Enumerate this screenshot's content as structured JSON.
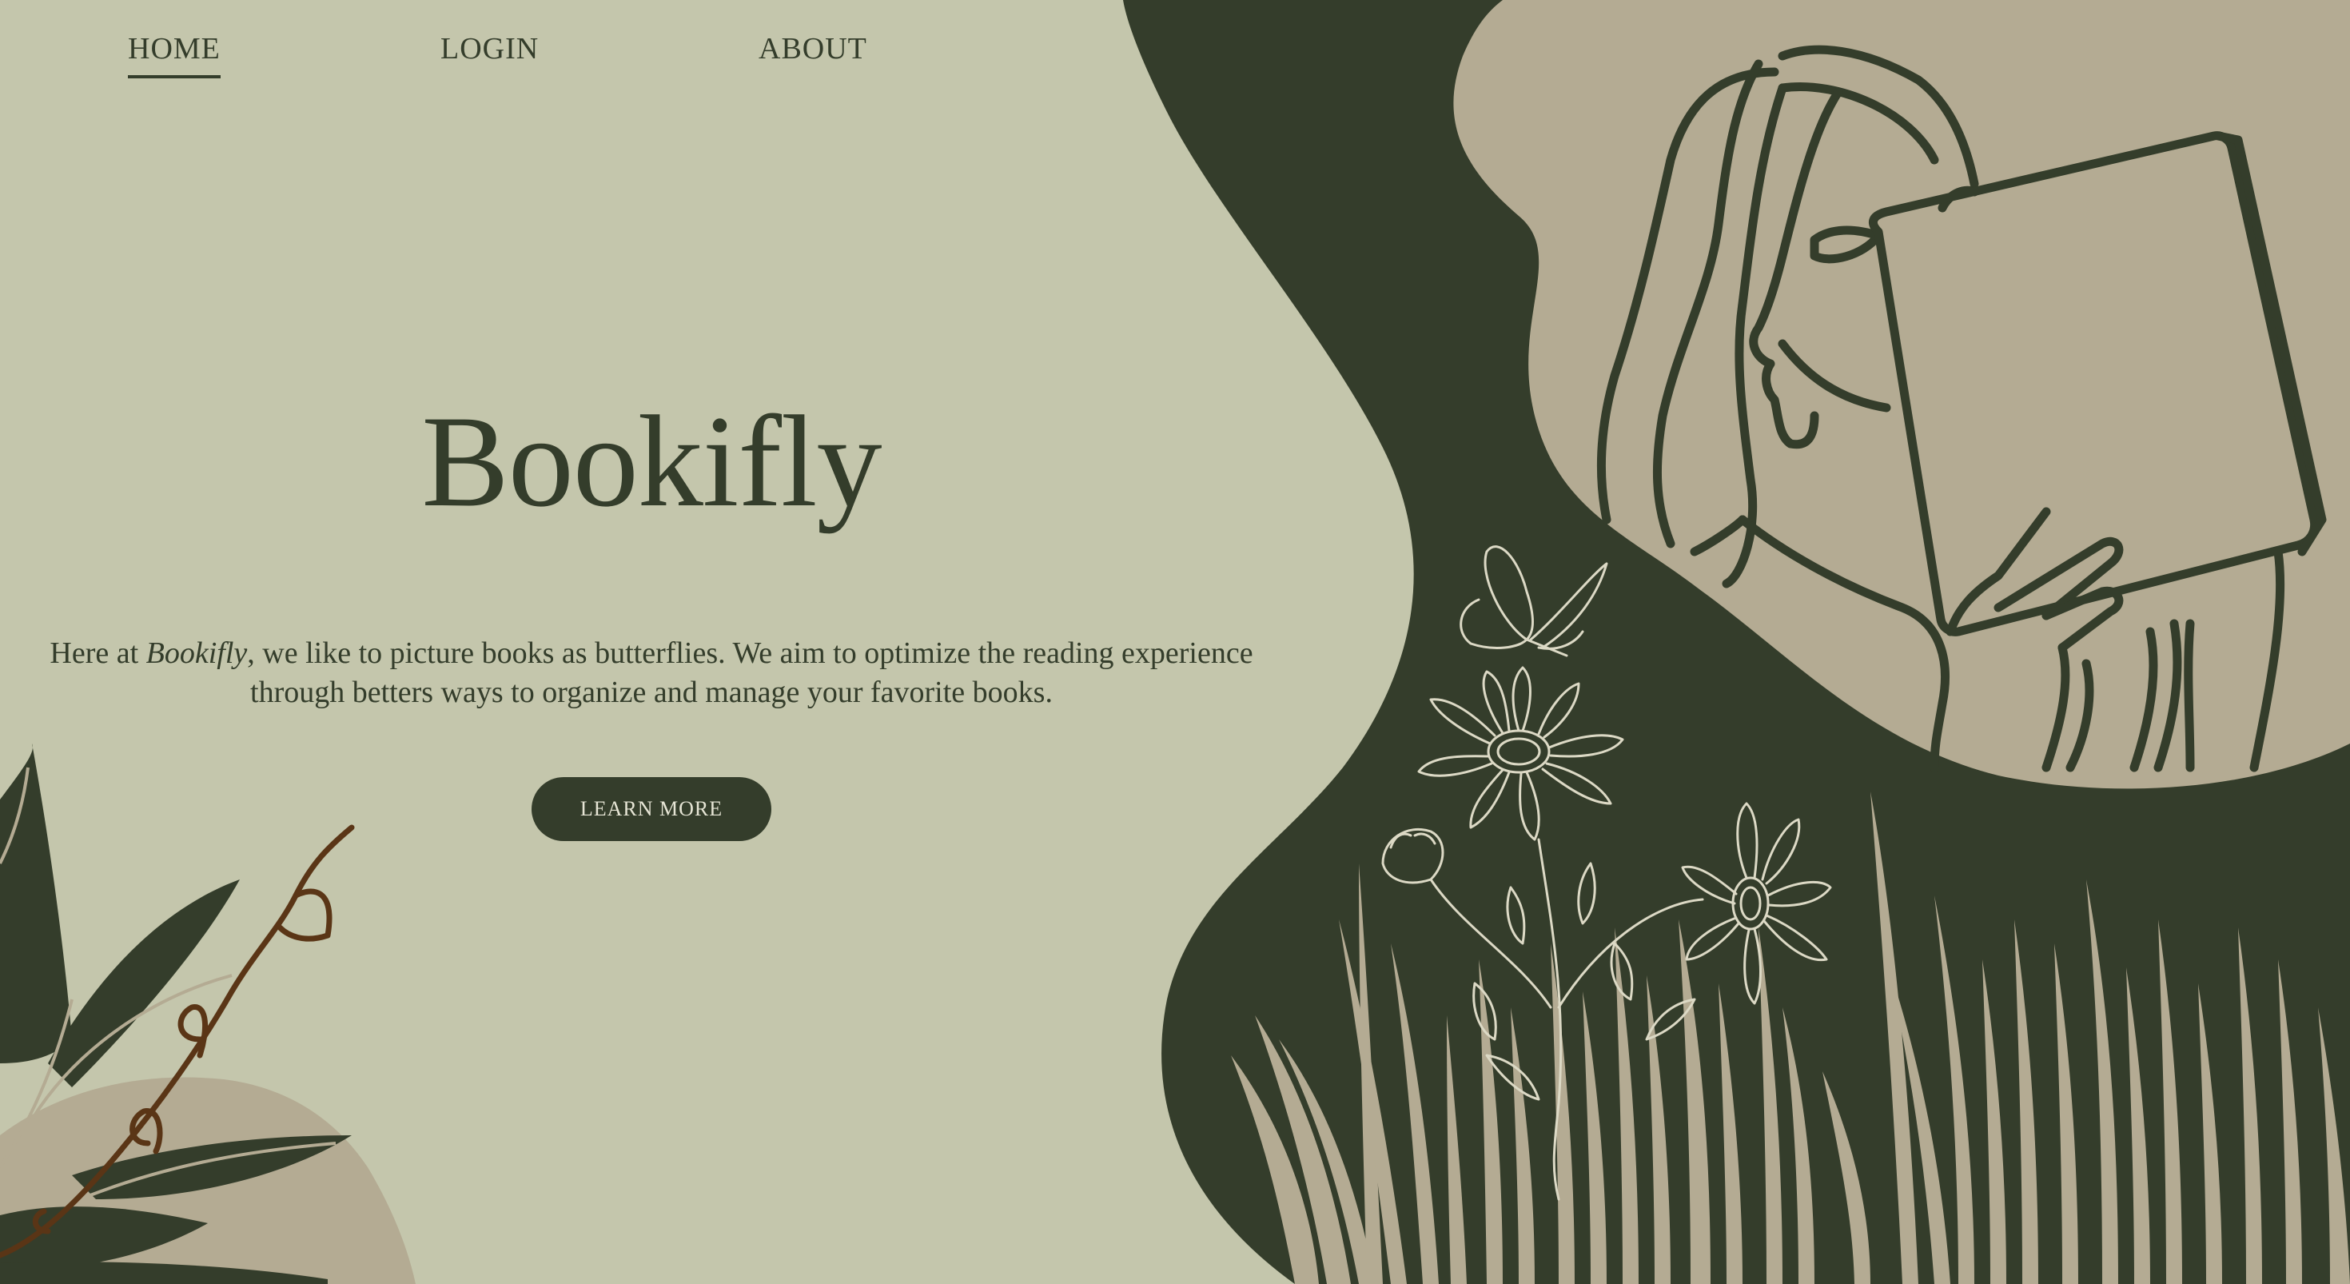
{
  "nav": {
    "items": [
      {
        "label": "HOME",
        "active": true
      },
      {
        "label": "LOGIN",
        "active": false
      },
      {
        "label": "ABOUT",
        "active": false
      }
    ]
  },
  "hero": {
    "title": "Bookifly",
    "text_prefix": "Here at ",
    "text_brand": "Bookifly",
    "text_suffix": ", we like to picture books as butterflies. We aim to optimize the reading experience through betters ways to organize and manage your favorite books.",
    "cta_label": "LEARN MORE"
  },
  "colors": {
    "background": "#c4c6ac",
    "dark_green": "#343d2b",
    "tan": "#b4ab93",
    "light_line": "#dcd9c5",
    "branch_brown": "#5a3516"
  },
  "icons": {
    "illustration": "woman-reading-book-illustration",
    "butterfly": "butterfly-icon",
    "flowers": "daisy-flowers-illustration",
    "grass": "grass-illustration",
    "plant": "plant-leaves-illustration"
  }
}
